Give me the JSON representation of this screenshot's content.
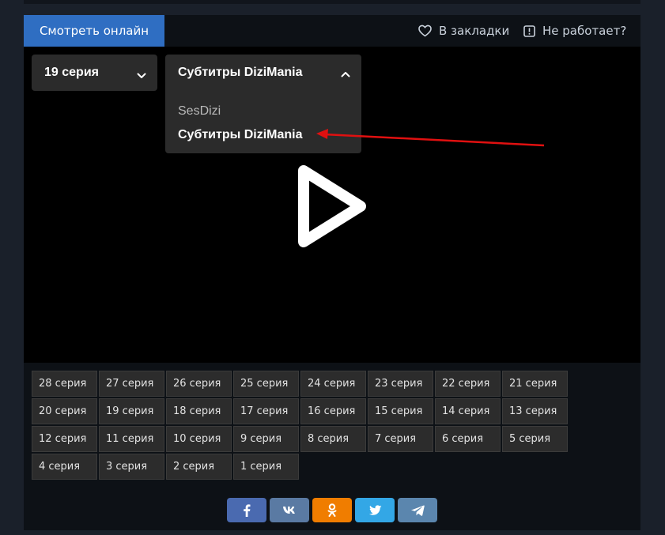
{
  "header": {
    "watch_tab": "Смотреть онлайн",
    "bookmark_label": "В закладки",
    "report_label": "Не работает?"
  },
  "player": {
    "episode_select": {
      "value": "19 серия"
    },
    "translation_select": {
      "value": "Субтитры DiziMania",
      "options": [
        "SesDizi",
        "Субтитры DiziMania"
      ],
      "selected_index": 1
    }
  },
  "episodes": [
    "28 серия",
    "27 серия",
    "26 серия",
    "25 серия",
    "24 серия",
    "23 серия",
    "22 серия",
    "21 серия",
    "20 серия",
    "19 серия",
    "18 серия",
    "17 серия",
    "16 серия",
    "15 серия",
    "14 серия",
    "13 серия",
    "12 серия",
    "11 серия",
    "10 серия",
    "9 серия",
    "8 серия",
    "7 серия",
    "6 серия",
    "5 серия",
    "4 серия",
    "3 серия",
    "2 серия",
    "1 серия"
  ],
  "share": [
    {
      "name": "facebook-share-button",
      "icon": "facebook-icon",
      "color": "#4a6ab0"
    },
    {
      "name": "vk-share-button",
      "icon": "vk-icon",
      "color": "#5a7aa3"
    },
    {
      "name": "odnoklassniki-share-button",
      "icon": "odnoklassniki-icon",
      "color": "#f07d00"
    },
    {
      "name": "twitter-share-button",
      "icon": "twitter-icon",
      "color": "#33a7e6"
    },
    {
      "name": "telegram-share-button",
      "icon": "telegram-icon",
      "color": "#5b86ae"
    }
  ],
  "colors": {
    "page_bg": "#1a202a",
    "panel_bg": "#0d1116",
    "accent": "#2f6ec2",
    "arrow": "#e01010"
  }
}
